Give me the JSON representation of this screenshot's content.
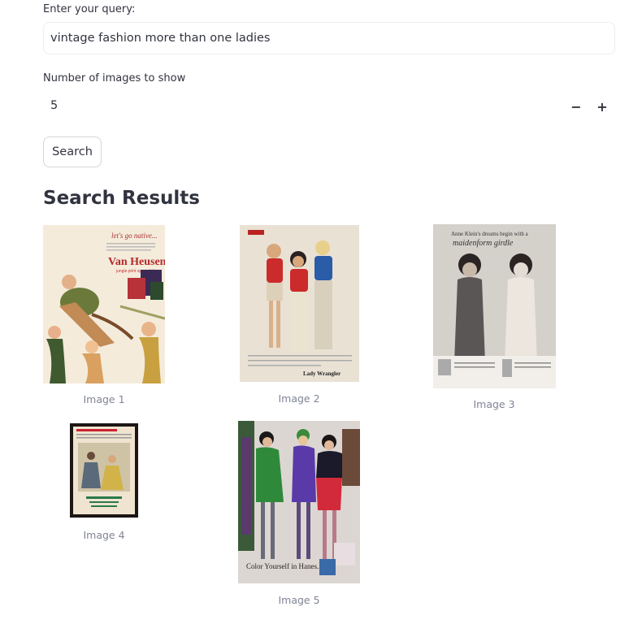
{
  "query": {
    "label": "Enter your query:",
    "value": "vintage fashion more than one ladies"
  },
  "num_images": {
    "label": "Number of images to show",
    "value": "5",
    "decrement": "−",
    "increment": "+"
  },
  "search_button": "Search",
  "results": {
    "heading": "Search Results",
    "images": [
      {
        "caption": "Image 1",
        "ad_text": [
          "let's go native...",
          "Van Heusen",
          "jungle print sport shirts"
        ]
      },
      {
        "caption": "Image 2",
        "ad_text": [
          "Lady Wrangler"
        ]
      },
      {
        "caption": "Image 3",
        "ad_text": [
          "Anne Klein's dreams begin with a",
          "maidenform girdle"
        ]
      },
      {
        "caption": "Image 4",
        "ad_text": []
      },
      {
        "caption": "Image 5",
        "ad_text": [
          "Color Yourself in Hanes."
        ]
      }
    ]
  },
  "colors": {
    "text": "#31333f",
    "caption": "#808495",
    "border": "#d6d6d9"
  }
}
